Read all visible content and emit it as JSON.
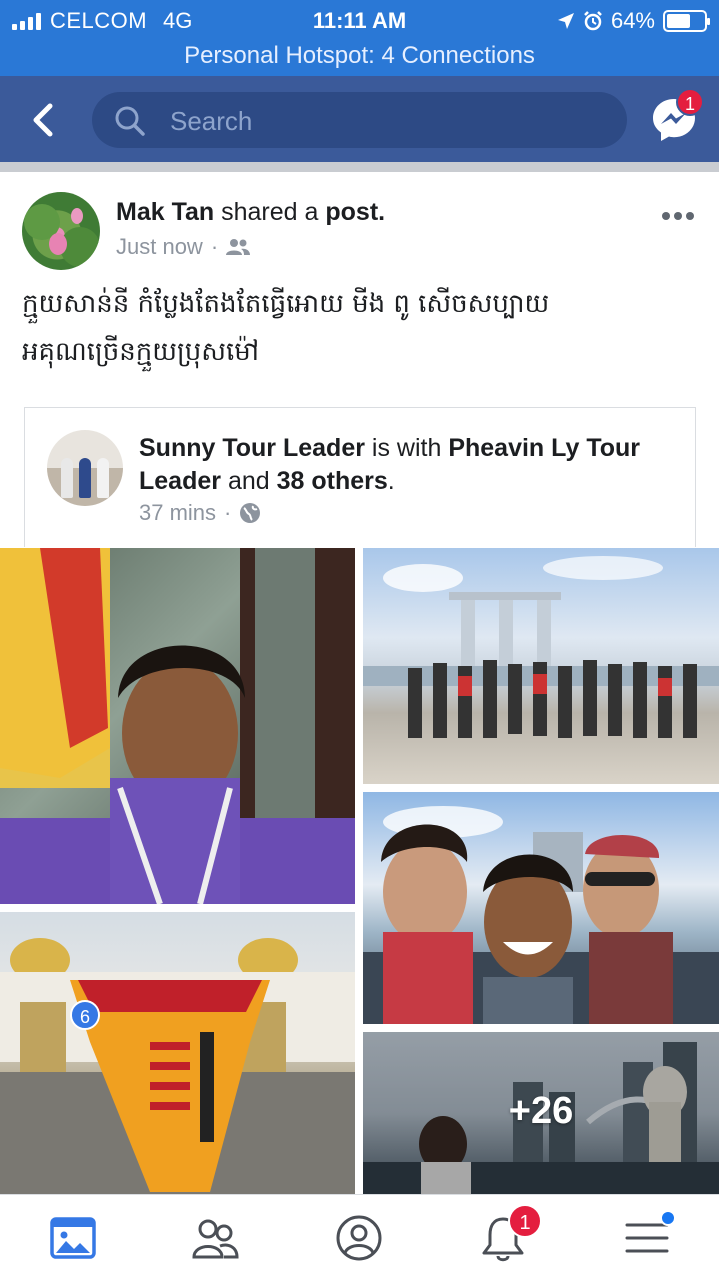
{
  "status_bar": {
    "carrier": "CELCOM",
    "network": "4G",
    "time": "11:11 AM",
    "battery_percent": "64%",
    "battery_level": 0.64,
    "hotspot": "Personal Hotspot: 4 Connections"
  },
  "navbar": {
    "search_placeholder": "Search",
    "messenger_badge": "1"
  },
  "post": {
    "author": "Mak Tan",
    "action": "shared a",
    "object": "post.",
    "time": "Just now",
    "audience_icon": "friends-icon",
    "text_line1": "ក្មួយសាន់នី កំប្លែងតែងតែធ្វើអោយ មីង ពូ សើចសប្បាយ",
    "text_line2": "អគុណច្រើនក្មួយប្រុសម៉ៅ",
    "shared": {
      "author": "Sunny Tour Leader",
      "with_text": "is with",
      "tagged": "Pheavin Ly Tour Leader",
      "and_text": "and",
      "others": "38 others",
      "period": ".",
      "time": "37 mins",
      "privacy_icon": "globe-icon"
    },
    "photos": {
      "more_count": "+26",
      "badge_count": "6"
    }
  },
  "tabbar": {
    "items": [
      "news-feed-icon",
      "friends-icon",
      "profile-icon",
      "notifications-icon",
      "menu-icon"
    ],
    "notifications_badge": "1",
    "accent": "#3578e5"
  }
}
